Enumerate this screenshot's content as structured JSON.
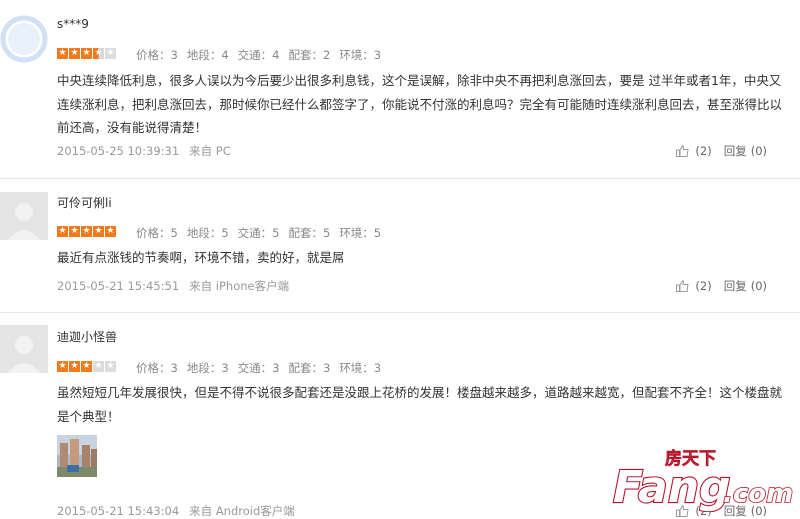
{
  "reviews": [
    {
      "user": "s***9",
      "stars": 3.5,
      "scores": {
        "price": "价格：3",
        "location": "地段：4",
        "transport": "交通：4",
        "facilities": "配套：2",
        "environment": "环境：3"
      },
      "content": "中央连续降低利息，很多人误以为今后要少出很多利息钱，这个是误解，除非中央不再把利息涨回去，要是 过半年或者1年，中央又连续涨利息，把利息涨回去，那时候你已经什么都签字了，你能说不付涨的利息吗？完全有可能随时连续涨利息回去，甚至涨得比以前还高，没有能说得清楚！",
      "time": "2015-05-25 10:39:31",
      "source": "来自 PC",
      "likes": "(2)",
      "reply_label": "回复",
      "reply_count": "(0)"
    },
    {
      "user": "可伶可俐li",
      "stars": 5,
      "scores": {
        "price": "价格：5",
        "location": "地段：5",
        "transport": "交通：5",
        "facilities": "配套：5",
        "environment": "环境：5"
      },
      "content": "最近有点涨钱的节奏啊，环境不错，卖的好，就是屌",
      "time": "2015-05-21 15:45:51",
      "source": "来自 iPhone客户端",
      "likes": "(2)",
      "reply_label": "回复",
      "reply_count": "(0)"
    },
    {
      "user": "迪迦小怪兽",
      "stars": 3,
      "scores": {
        "price": "价格：3",
        "location": "地段：3",
        "transport": "交通：3",
        "facilities": "配套：3",
        "environment": "环境：3"
      },
      "content": "虽然短短几年发展很快，但是不得不说很多配套还是没跟上花桥的发展！楼盘越来越多，道路越来越宽，但配套不齐全！这个楼盘就是个典型！",
      "time": "2015-05-21 15:43:04",
      "source": "来自 Android客户端",
      "likes": "(2)",
      "reply_label": "回复",
      "reply_count": "(0)"
    }
  ],
  "watermark": {
    "brand": "Fang",
    "suffix": ".com",
    "chinese": "房天下"
  },
  "colors": {
    "star": "#f07b1e",
    "watermark": "#b8142a"
  },
  "icons": {
    "like": "thumbs-up-icon",
    "avatar": "default-avatar-icon"
  }
}
